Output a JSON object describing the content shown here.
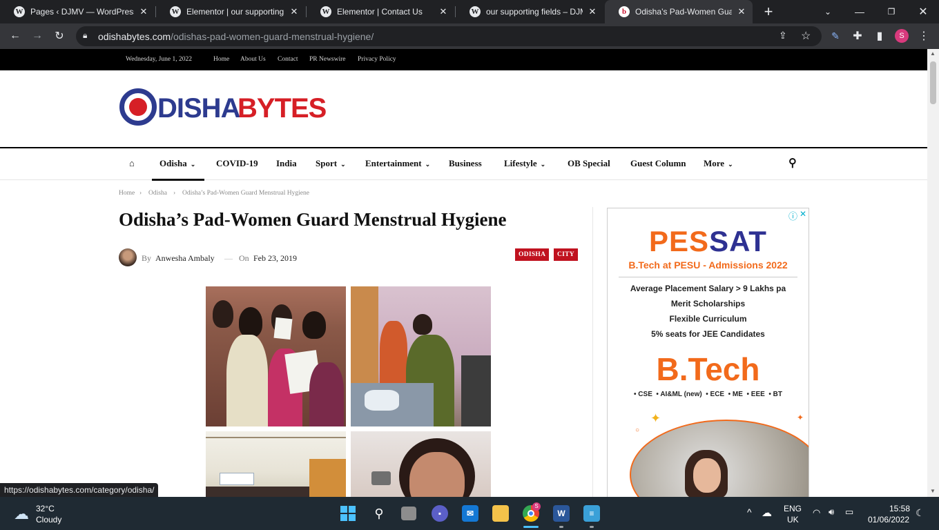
{
  "browser": {
    "tabs": [
      {
        "title": "Pages ‹ DJMV — WordPress",
        "icon": "wordpress-icon"
      },
      {
        "title": "Elementor | our supporting fi",
        "icon": "wordpress-icon"
      },
      {
        "title": "Elementor | Contact Us",
        "icon": "wordpress-icon"
      },
      {
        "title": "our supporting fields – DJMV",
        "icon": "wordpress-icon"
      },
      {
        "title": "Odisha’s Pad-Women Guard",
        "icon": "odishabytes-favicon",
        "active": true
      }
    ],
    "url_domain": "odishabytes.com",
    "url_path": "/odishas-pad-women-guard-menstrual-hygiene/",
    "profile_initial": "S",
    "hover_status_url": "https://odishabytes.com/category/odisha/"
  },
  "site": {
    "topbar": {
      "date": "Wednesday, June 1, 2022",
      "links": [
        "Home",
        "About Us",
        "Contact",
        "PR Newswire",
        "Privacy Policy"
      ]
    },
    "logo": {
      "part1": "DISHA",
      "part2": "BYTES",
      "blue": "#2d3b8f",
      "red": "#d61f26"
    },
    "nav": [
      {
        "label": "Odisha",
        "dropdown": true
      },
      {
        "label": "COVID-19",
        "dropdown": false
      },
      {
        "label": "India",
        "dropdown": false
      },
      {
        "label": "Sport",
        "dropdown": true
      },
      {
        "label": "Entertainment",
        "dropdown": true
      },
      {
        "label": "Business",
        "dropdown": false
      },
      {
        "label": "Lifestyle",
        "dropdown": true
      },
      {
        "label": "OB Special",
        "dropdown": false
      },
      {
        "label": "Guest Column",
        "dropdown": false
      },
      {
        "label": "More",
        "dropdown": true
      }
    ]
  },
  "article": {
    "breadcrumb": [
      "Home",
      "Odisha",
      "Odisha’s Pad-Women Guard Menstrual Hygiene"
    ],
    "title": "Odisha’s Pad-Women Guard Menstrual Hygiene",
    "by_label": "By",
    "author": "Anwesha Ambaly",
    "dash": "—",
    "on_label": "On",
    "date": "Feb 23, 2019",
    "tags": [
      "ODISHA",
      "CITY"
    ],
    "tag_color": "#c0121f"
  },
  "ad": {
    "brand_part1": "PES",
    "brand_part2": "SAT",
    "headline": "B.Tech at PESU - Admissions 2022",
    "points": [
      "Average Placement Salary > 9 Lakhs pa",
      "Merit Scholarships",
      "Flexible Curriculum",
      "5% seats for JEE Candidates"
    ],
    "big": "B.Tech",
    "branches": "• CSE  • AI&ML (new)  • ECE  • ME  • EEE  • BT",
    "info_icon": "ⓘ",
    "close_icon": "✕"
  },
  "taskbar": {
    "temperature": "32°C",
    "weather": "Cloudy",
    "lang_line1": "ENG",
    "lang_line2": "UK",
    "time": "15:58",
    "date": "01/06/2022"
  }
}
